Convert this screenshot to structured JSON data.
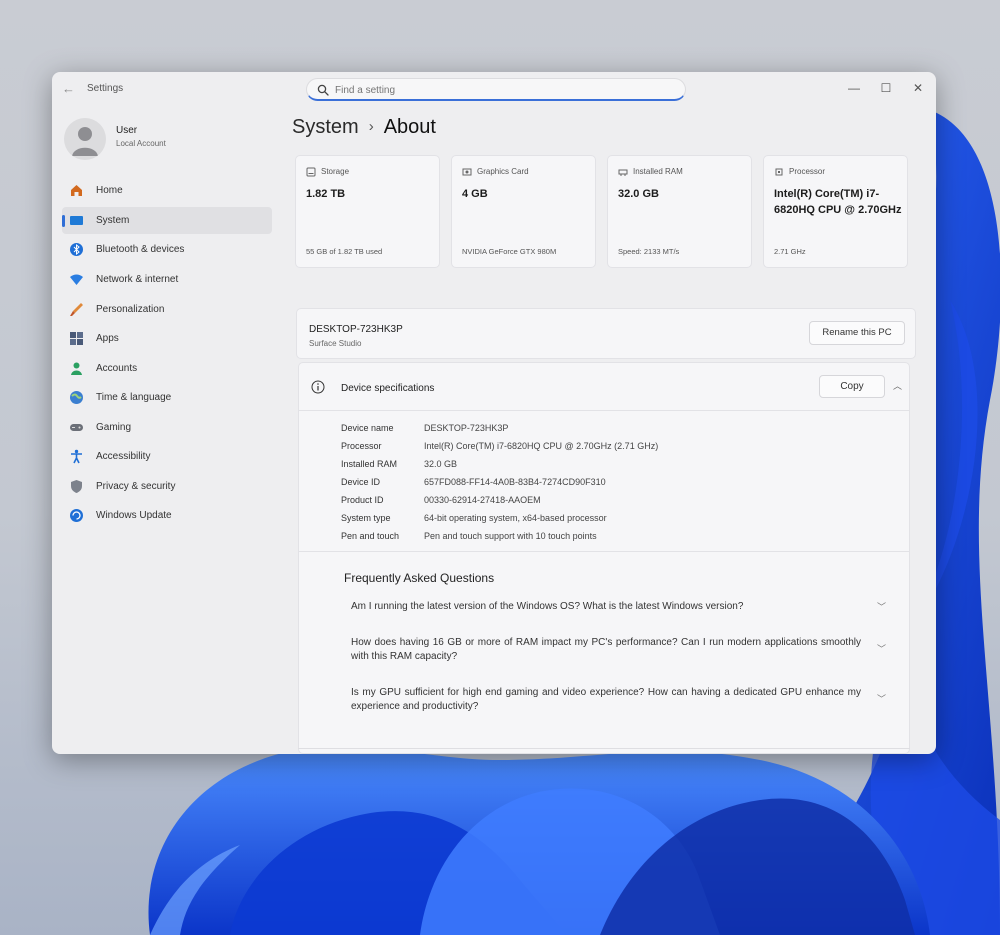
{
  "window": {
    "app_title": "Settings",
    "search": {
      "placeholder": "Find a setting"
    },
    "controls": {
      "minimize": "—",
      "maximize": "☐",
      "close": "✕"
    }
  },
  "user": {
    "name": "User",
    "account_type": "Local Account"
  },
  "sidebar": {
    "items": [
      {
        "label": "Home",
        "icon": "home-icon"
      },
      {
        "label": "System",
        "icon": "system-icon",
        "active": true
      },
      {
        "label": "Bluetooth & devices",
        "icon": "bluetooth-icon"
      },
      {
        "label": "Network & internet",
        "icon": "wifi-icon"
      },
      {
        "label": "Personalization",
        "icon": "brush-icon"
      },
      {
        "label": "Apps",
        "icon": "apps-icon"
      },
      {
        "label": "Accounts",
        "icon": "person-icon"
      },
      {
        "label": "Time & language",
        "icon": "globe-icon"
      },
      {
        "label": "Gaming",
        "icon": "gamepad-icon"
      },
      {
        "label": "Accessibility",
        "icon": "accessibility-icon"
      },
      {
        "label": "Privacy & security",
        "icon": "shield-icon"
      },
      {
        "label": "Windows Update",
        "icon": "update-icon"
      }
    ]
  },
  "breadcrumb": {
    "parent": "System",
    "separator": "›",
    "current": "About"
  },
  "cards": [
    {
      "label": "Storage",
      "value": "1.82 TB",
      "sub": "55 GB of 1.82 TB used",
      "icon": "storage-icon"
    },
    {
      "label": "Graphics Card",
      "value": "4 GB",
      "sub": "NVIDIA GeForce GTX 980M",
      "icon": "gpu-icon"
    },
    {
      "label": "Installed RAM",
      "value": "32.0 GB",
      "sub": "Speed: 2133 MT/s",
      "icon": "ram-icon"
    },
    {
      "label": "Processor",
      "value": "Intel(R) Core(TM) i7-6820HQ CPU @ 2.70GHz",
      "sub": "2.71 GHz",
      "icon": "processor-icon"
    }
  ],
  "pc": {
    "name": "DESKTOP-723HK3P",
    "model": "Surface Studio",
    "rename_label": "Rename this PC"
  },
  "specs": {
    "title": "Device specifications",
    "copy_label": "Copy",
    "rows": [
      {
        "key": "Device name",
        "value": "DESKTOP-723HK3P"
      },
      {
        "key": "Processor",
        "value": "Intel(R) Core(TM) i7-6820HQ CPU @ 2.70GHz (2.71 GHz)"
      },
      {
        "key": "Installed RAM",
        "value": "32.0 GB"
      },
      {
        "key": "Device ID",
        "value": "657FD088-FF14-4A0B-83B4-7274CD90F310"
      },
      {
        "key": "Product ID",
        "value": "00330-62914-27418-AAOEM"
      },
      {
        "key": "System type",
        "value": "64-bit operating system, x64-based processor"
      },
      {
        "key": "Pen and touch",
        "value": "Pen and touch support with 10 touch points"
      }
    ]
  },
  "faq": {
    "title": "Frequently Asked Questions",
    "items": [
      {
        "question": "Am I running the latest version of the Windows OS? What is the latest Windows version?"
      },
      {
        "question": "How does having 16 GB or more of RAM impact my PC's performance? Can I run modern applications smoothly with this RAM capacity?"
      },
      {
        "question": "Is my GPU sufficient for high end gaming and video experience? How can having a dedicated GPU enhance my experience and productivity?"
      }
    ]
  },
  "colors": {
    "accent": "#2f6ed6",
    "window_bg": "#eeeef0",
    "card_bg": "#f6f6f8"
  }
}
